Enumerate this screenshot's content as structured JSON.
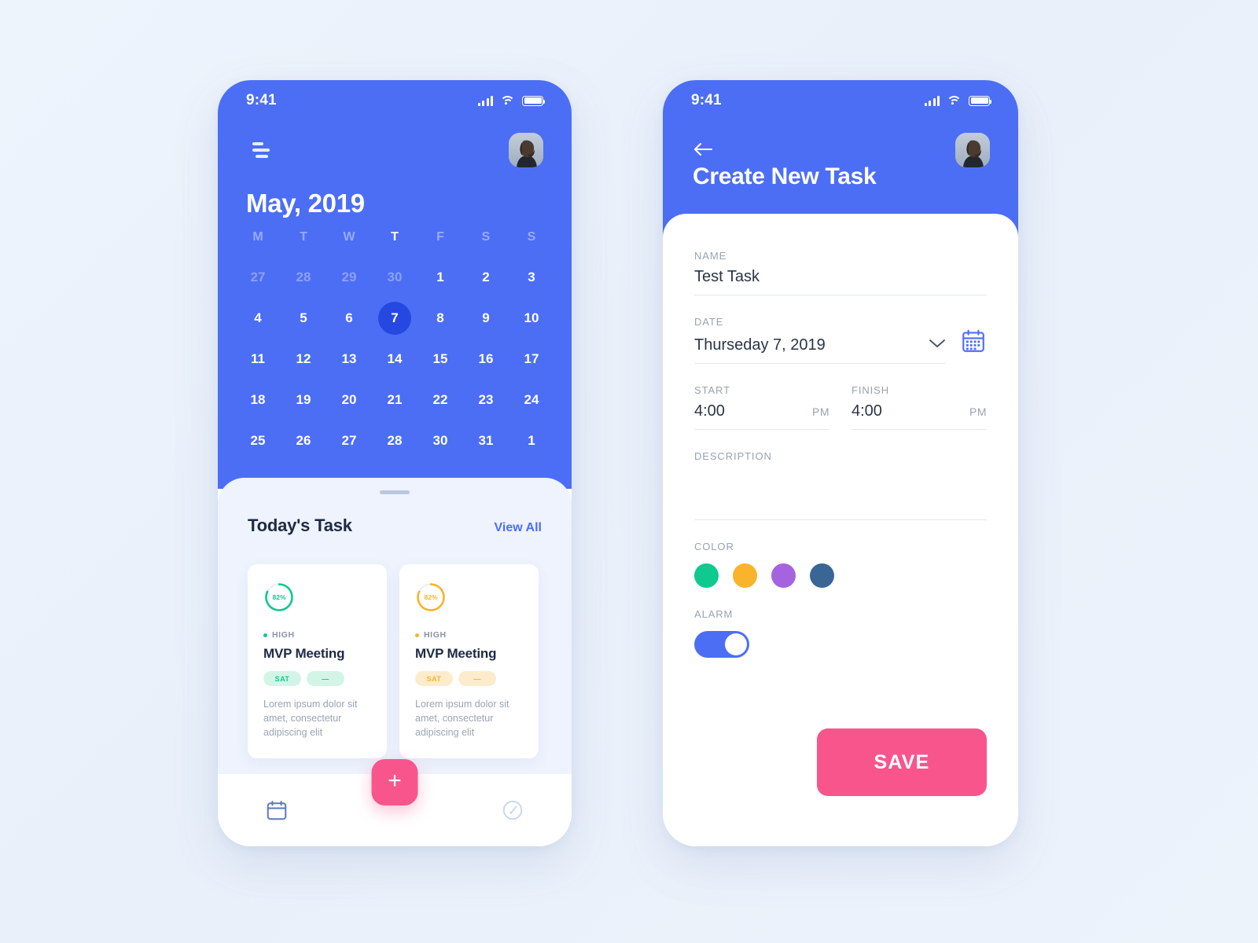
{
  "theme": {
    "primary_blue": "#4c6ef5",
    "today_blue": "#2549e0",
    "pink": "#f9558d",
    "page_bg": "#eef3fb",
    "sheet_bg": "#eef3fd",
    "green": "#10c98f",
    "orange": "#f9b42c",
    "dark_text": "#1e2a44",
    "muted_text": "#9aa3b4"
  },
  "left_phone": {
    "status": {
      "time": "9:41",
      "signal_icon": "cellular-bars-icon",
      "wifi_icon": "wifi-icon",
      "battery_icon": "battery-full-icon"
    },
    "menu_icon": "hamburger-menu-icon",
    "avatar_icon": "user-avatar",
    "month_title": "May, 2019",
    "calendar": {
      "weekdays": [
        "M",
        "T",
        "W",
        "T",
        "F",
        "S",
        "S"
      ],
      "active_weekday_index": 3,
      "weeks": [
        [
          {
            "d": "27",
            "muted": true
          },
          {
            "d": "28",
            "muted": true
          },
          {
            "d": "29",
            "muted": true
          },
          {
            "d": "30",
            "muted": true
          },
          {
            "d": "1",
            "muted": false
          },
          {
            "d": "2",
            "muted": false
          },
          {
            "d": "3",
            "muted": false
          }
        ],
        [
          {
            "d": "4",
            "muted": false
          },
          {
            "d": "5",
            "muted": false
          },
          {
            "d": "6",
            "muted": false
          },
          {
            "d": "7",
            "muted": false,
            "today": true
          },
          {
            "d": "8",
            "muted": false
          },
          {
            "d": "9",
            "muted": false
          },
          {
            "d": "10",
            "muted": false
          }
        ],
        [
          {
            "d": "11",
            "muted": false
          },
          {
            "d": "12",
            "muted": false
          },
          {
            "d": "13",
            "muted": false
          },
          {
            "d": "14",
            "muted": false
          },
          {
            "d": "15",
            "muted": false
          },
          {
            "d": "16",
            "muted": false
          },
          {
            "d": "17",
            "muted": false
          }
        ],
        [
          {
            "d": "18",
            "muted": false
          },
          {
            "d": "19",
            "muted": false
          },
          {
            "d": "20",
            "muted": false
          },
          {
            "d": "21",
            "muted": false
          },
          {
            "d": "22",
            "muted": false
          },
          {
            "d": "23",
            "muted": false
          },
          {
            "d": "24",
            "muted": false
          }
        ],
        [
          {
            "d": "25",
            "muted": false
          },
          {
            "d": "26",
            "muted": false
          },
          {
            "d": "27",
            "muted": false
          },
          {
            "d": "28",
            "muted": false
          },
          {
            "d": "30",
            "muted": false
          },
          {
            "d": "31",
            "muted": false
          },
          {
            "d": "1",
            "muted": false
          }
        ]
      ],
      "selected_day": "7"
    },
    "sheet": {
      "title": "Today's Task",
      "view_all": "View All",
      "cards": [
        {
          "progress": "82%",
          "progress_value": 82,
          "color": "#10c98f",
          "chip_bg": "#d3f5e8",
          "priority": "HIGH",
          "title": "MVP Meeting",
          "chips": [
            "SAT",
            "—"
          ],
          "description": "Lorem ipsum dolor sit amet, consectetur adipiscing elit"
        },
        {
          "progress": "82%",
          "progress_value": 82,
          "color": "#f9b42c",
          "chip_bg": "#fdeccc",
          "priority": "HIGH",
          "title": "MVP Meeting",
          "chips": [
            "SAT",
            "—"
          ],
          "description": "Lorem ipsum dolor sit amet, consectetur adipiscing elit"
        }
      ]
    },
    "bottom_nav": {
      "calendar_icon": "calendar-icon",
      "add_icon": "plus-icon",
      "stats_icon": "speedometer-icon"
    }
  },
  "right_phone": {
    "status": {
      "time": "9:41",
      "signal_icon": "cellular-bars-icon",
      "wifi_icon": "wifi-icon",
      "battery_icon": "battery-full-icon"
    },
    "back_icon": "arrow-left-icon",
    "avatar_icon": "user-avatar",
    "page_title": "Create New Task",
    "form": {
      "name_label": "NAME",
      "name_value": "Test Task",
      "date_label": "DATE",
      "date_value": "Thurseday 7, 2019",
      "date_dropdown_icon": "chevron-down-icon",
      "date_picker_icon": "calendar-picker-icon",
      "start_label": "START",
      "start_value": "4:00",
      "start_ampm": "PM",
      "finish_label": "FINISH",
      "finish_value": "4:00",
      "finish_ampm": "PM",
      "description_label": "DESCRIPTION",
      "description_value": "",
      "color_label": "COLOR",
      "colors": [
        "#10c98f",
        "#f9b42c",
        "#a663e0",
        "#3a6695"
      ],
      "alarm_label": "ALARM",
      "alarm_on": true,
      "save_label": "SAVE"
    }
  }
}
